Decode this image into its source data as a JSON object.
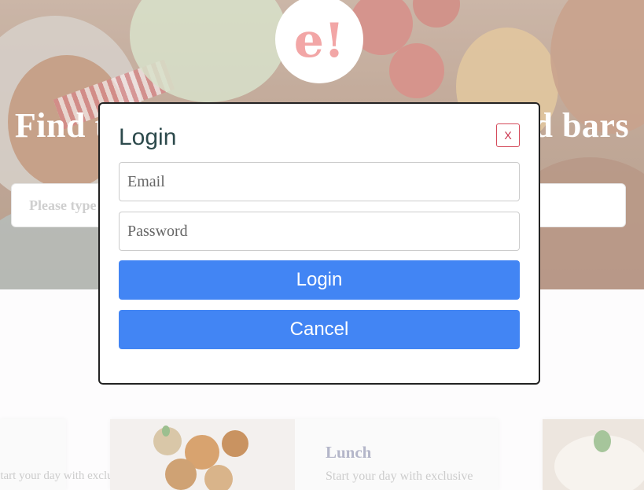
{
  "logo": {
    "text": "e!"
  },
  "hero": {
    "title": "Find the best restaurants, cafés and bars",
    "search_placeholder": "Please type a location"
  },
  "cards": {
    "left_desc": "Start your day with exclusive",
    "mid_title": "Lunch",
    "mid_desc": "Start your day with exclusive"
  },
  "modal": {
    "title": "Login",
    "close_label": "X",
    "email_placeholder": "Email",
    "password_placeholder": "Password",
    "login_label": "Login",
    "cancel_label": "Cancel"
  },
  "colors": {
    "primary_button": "#4285f4",
    "close_border": "#d44a5a",
    "logo_text": "#f2a6a6"
  }
}
